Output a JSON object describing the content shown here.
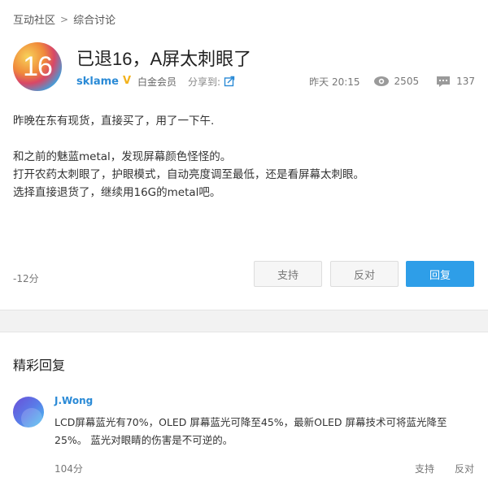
{
  "breadcrumb": {
    "root": "互动社区",
    "separator": ">",
    "section": "综合讨论"
  },
  "post": {
    "avatar_text": "16",
    "title": "已退16，A屏太刺眼了",
    "author": "sklame",
    "badge": "V",
    "level": "白金会员",
    "share_label": "分享到:",
    "time": "昨天 20:15",
    "views": "2505",
    "replies": "137",
    "paragraphs": [
      "昨晚在东有现货，直接买了，用了一下午.",
      "",
      "和之前的魅蓝metal，发现屏幕颜色怪怪的。",
      "打开农药太刺眼了，护眼模式，自动亮度调至最低，还是看屏幕太刺眼。",
      "选择直接退货了，继续用16G的metal吧。"
    ],
    "score": "-12分",
    "buttons": {
      "support": "支持",
      "oppose": "反对",
      "reply": "回复"
    }
  },
  "highlights": {
    "title": "精彩回复",
    "reply": {
      "author": "J.Wong",
      "text": "LCD屏幕蓝光有70%，OLED 屏幕蓝光可降至45%，最新OLED 屏幕技术可将蓝光降至25%。 蓝光对眼睛的伤害是不可逆的。",
      "score": "104分",
      "support": "支持",
      "oppose": "反对"
    }
  },
  "colors": {
    "accent": "#2e9ee8",
    "link": "#2a8ad6",
    "badge": "#f3b21c"
  },
  "icons": {
    "share": "share-icon",
    "views": "eye-icon",
    "replies": "comment-icon"
  }
}
